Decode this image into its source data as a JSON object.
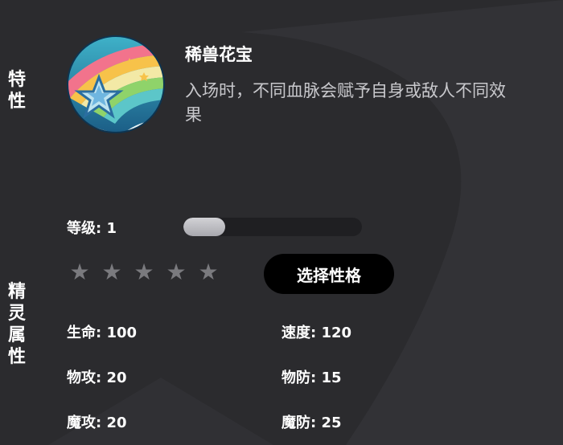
{
  "side_labels": {
    "trait": [
      "特",
      "性"
    ],
    "attributes": [
      "精",
      "灵",
      "属",
      "性"
    ]
  },
  "trait": {
    "name": "稀兽花宝",
    "description": "入场时，不同血脉会赋予自身或敌人不同效果",
    "icon": "rainbow-star-emblem-icon"
  },
  "level": {
    "label": "等级: 1",
    "progress_fraction": 0.23
  },
  "stars": {
    "filled": 0,
    "total": 5,
    "glyphs": [
      "★",
      "★",
      "★",
      "★",
      "★"
    ]
  },
  "choose_button_label": "选择性格",
  "stats": {
    "hp": "生命: 100",
    "speed": "速度: 120",
    "phys_atk": "物攻: 20",
    "phys_def": "物防: 15",
    "mag_atk": "魔攻: 20",
    "mag_def": "魔防: 25"
  },
  "colors": {
    "background": "#2b2b2e",
    "button": "#000000",
    "star_empty": "#7a7a7e"
  }
}
